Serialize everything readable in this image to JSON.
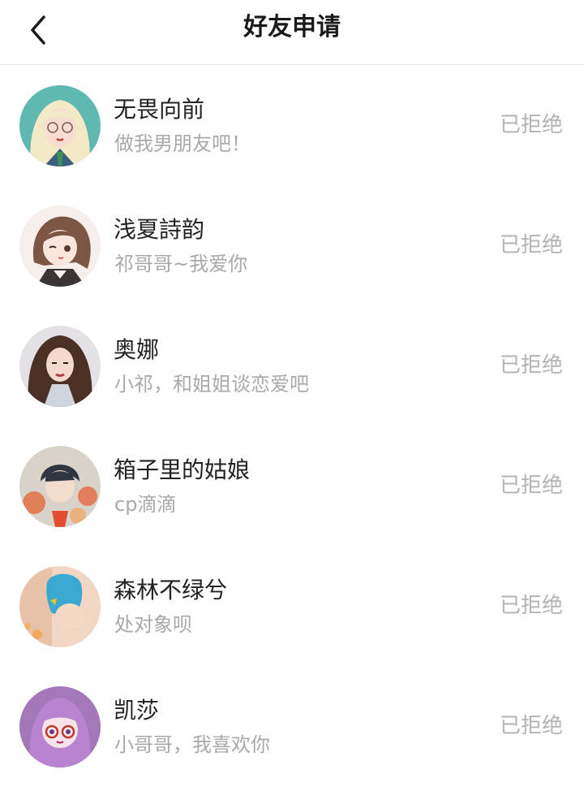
{
  "header": {
    "title": "好友申请",
    "back_icon": "chevron-left-icon"
  },
  "requests": [
    {
      "name": "无畏向前",
      "message": "做我男朋友吧！",
      "status": "已拒绝",
      "avatar_bg": "#7fc7c0"
    },
    {
      "name": "浅夏詩韵",
      "message": "祁哥哥~我爱你",
      "status": "已拒绝",
      "avatar_bg": "#f1e6e2"
    },
    {
      "name": "奥娜",
      "message": "小祁，和姐姐谈恋爱吧",
      "status": "已拒绝",
      "avatar_bg": "#d9d6dc"
    },
    {
      "name": "箱子里的姑娘",
      "message": "cp滴滴",
      "status": "已拒绝",
      "avatar_bg": "#c97a55"
    },
    {
      "name": "森林不绿兮",
      "message": "处对象呗",
      "status": "已拒绝",
      "avatar_bg": "#e9cbb7"
    },
    {
      "name": "凯莎",
      "message": "小哥哥，我喜欢你",
      "status": "已拒绝",
      "avatar_bg": "#b78ac9"
    }
  ]
}
